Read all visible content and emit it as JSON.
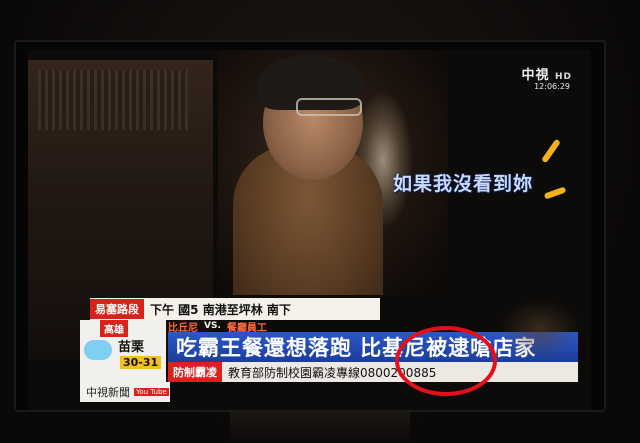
{
  "broadcast": {
    "channel_logo": "中視",
    "channel_logo_suffix": "HD",
    "time": "12:06:29"
  },
  "overlay_subtitle": "如果我沒看到妳",
  "traffic_row": {
    "tag": "易塞路段",
    "text": "下午  國5 南港至坪林 南下"
  },
  "subheadline": {
    "left": "比丘尼",
    "vs": "VS.",
    "right": "餐廳員工"
  },
  "headline": "吃霸王餐還想落跑 比基尼被逮嗆店家",
  "bottom_row": {
    "tag": "防制霸凌",
    "text": "教育部防制校園霸凌專線0800200885"
  },
  "weather": {
    "tag": "高雄",
    "city": "苗栗",
    "temp": "30-31"
  },
  "station": {
    "name": "中視新聞",
    "yt_label": "You Tube"
  },
  "annotation": {
    "color": "#e3101a"
  },
  "colors": {
    "headline_blue": "#1b3d9c",
    "tag_red": "#d8221b",
    "subtitle_blue": "#c8d9ff"
  }
}
